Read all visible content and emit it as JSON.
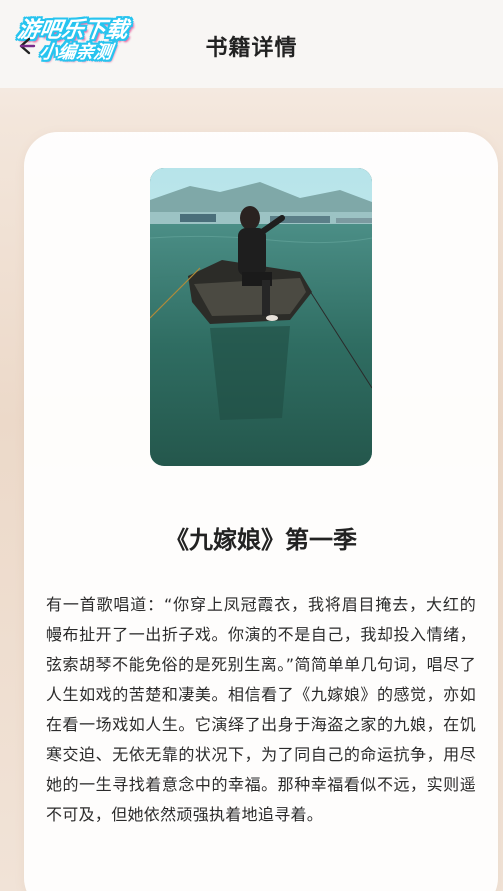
{
  "header": {
    "title": "书籍详情",
    "back_icon": "back-arrow-icon"
  },
  "watermark": {
    "line1": "游吧乐下载",
    "line2": "小编亲测",
    "outline_color": "#27c4ef",
    "shadow_color": "#e03a8a"
  },
  "book": {
    "cover_alt": "cover-image",
    "title": "《九嫁娘》第一季",
    "description": "有一首歌唱道：“你穿上凤冠霞衣，我将眉目掩去，大红的幔布扯开了一出折子戏。你演的不是自己，我却投入情绪，弦索胡琴不能免俗的是死别生离。”简简单单几句词，唱尽了人生如戏的苦楚和凄美。相信看了《九嫁娘》的感觉，亦如在看一场戏如人生。它演绎了出身于海盗之家的九娘，在饥寒交迫、无依无靠的状况下，为了同自己的命运抗争，用尽她的一生寻找着意念中的幸福。那种幸福看似不远，实则遥不可及，但她依然顽强执着地追寻着。"
  },
  "colors": {
    "background_top": "#f7f2ee",
    "background_mid": "#ecd9c9",
    "card": "#ffffff",
    "text": "#222222"
  }
}
